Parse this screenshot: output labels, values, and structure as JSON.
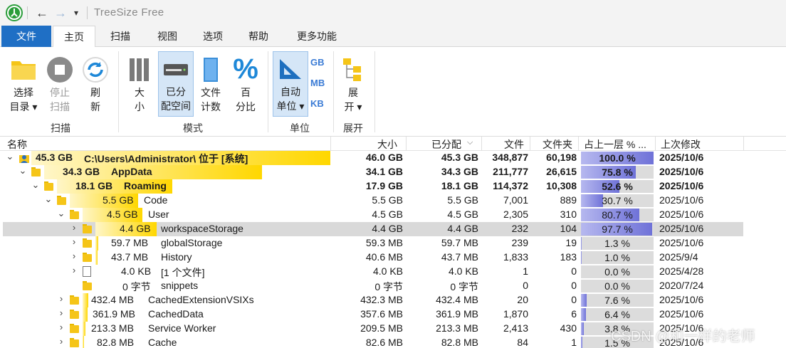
{
  "titlebar": {
    "title": "TreeSize Free",
    "quick_dropdown": "▾"
  },
  "menu": {
    "tabs": [
      "文件",
      "主页",
      "扫描",
      "视图",
      "选项",
      "帮助",
      "更多功能"
    ]
  },
  "ribbon": {
    "select_dir": [
      "选择",
      "目录 ▾"
    ],
    "stop_scan": [
      "停止",
      "扫描"
    ],
    "refresh": [
      "刷",
      "新"
    ],
    "size": [
      "大",
      "小"
    ],
    "allocated": [
      "已分",
      "配空间"
    ],
    "file_count": [
      "文件",
      "计数"
    ],
    "percent": [
      "百",
      "分比"
    ],
    "auto_unit": [
      "自动",
      "单位 ▾"
    ],
    "units": [
      "GB",
      "MB",
      "KB"
    ],
    "expand": [
      "展",
      "开 ▾"
    ],
    "groups": [
      "扫描",
      "模式",
      "单位",
      "展开"
    ]
  },
  "columns": [
    "名称",
    "大小",
    "已分配",
    "文件",
    "文件夹",
    "占上一层 % ...",
    "上次修改"
  ],
  "rows": [
    {
      "name_size": "45.3 GB",
      "name": "C:\\Users\\Administrator\\  位于  [系统]",
      "size": "46.0 GB",
      "allocated": "45.3 GB",
      "files": "348,877",
      "folders": "60,198",
      "pct": "100.0 %",
      "pct_value": 100.0,
      "modified": "2025/10/6",
      "bold": true
    },
    {
      "name_size": "34.3 GB",
      "name": "AppData",
      "size": "34.1 GB",
      "allocated": "34.3 GB",
      "files": "211,777",
      "folders": "26,615",
      "pct": "75.8 %",
      "pct_value": 75.8,
      "modified": "2025/10/6",
      "bold": true
    },
    {
      "name_size": "18.1 GB",
      "name": "Roaming",
      "size": "17.9 GB",
      "allocated": "18.1 GB",
      "files": "114,372",
      "folders": "10,308",
      "pct": "52.6 %",
      "pct_value": 52.6,
      "modified": "2025/10/6",
      "bold": true
    },
    {
      "name_size": "5.5 GB",
      "name": "Code",
      "size": "5.5 GB",
      "allocated": "5.5 GB",
      "files": "7,001",
      "folders": "889",
      "pct": "30.7 %",
      "pct_value": 30.7,
      "modified": "2025/10/6",
      "bold": false
    },
    {
      "name_size": "4.5 GB",
      "name": "User",
      "size": "4.5 GB",
      "allocated": "4.5 GB",
      "files": "2,305",
      "folders": "310",
      "pct": "80.7 %",
      "pct_value": 80.7,
      "modified": "2025/10/6",
      "bold": false
    },
    {
      "name_size": "4.4 GB",
      "name": "workspaceStorage",
      "size": "4.4 GB",
      "allocated": "4.4 GB",
      "files": "232",
      "folders": "104",
      "pct": "97.7 %",
      "pct_value": 97.7,
      "modified": "2025/10/6",
      "bold": false
    },
    {
      "name_size": "59.7 MB",
      "name": "globalStorage",
      "size": "59.3 MB",
      "allocated": "59.7 MB",
      "files": "239",
      "folders": "19",
      "pct": "1.3 %",
      "pct_value": 1.3,
      "modified": "2025/10/6",
      "bold": false
    },
    {
      "name_size": "43.7 MB",
      "name": "History",
      "size": "40.6 MB",
      "allocated": "43.7 MB",
      "files": "1,833",
      "folders": "183",
      "pct": "1.0 %",
      "pct_value": 1.0,
      "modified": "2025/9/4",
      "bold": false
    },
    {
      "name_size": "4.0 KB",
      "name": "[1 个文件]",
      "size": "4.0 KB",
      "allocated": "4.0 KB",
      "files": "1",
      "folders": "0",
      "pct": "0.0 %",
      "pct_value": 0.0,
      "modified": "2025/4/28",
      "bold": false
    },
    {
      "name_size": "0 字节",
      "name": "snippets",
      "size": "0 字节",
      "allocated": "0 字节",
      "files": "0",
      "folders": "0",
      "pct": "0.0 %",
      "pct_value": 0.0,
      "modified": "2020/7/24",
      "bold": false
    },
    {
      "name_size": "432.4 MB",
      "name": "CachedExtensionVSIXs",
      "size": "432.3 MB",
      "allocated": "432.4 MB",
      "files": "20",
      "folders": "0",
      "pct": "7.6 %",
      "pct_value": 7.6,
      "modified": "2025/10/6",
      "bold": false
    },
    {
      "name_size": "361.9 MB",
      "name": "CachedData",
      "size": "357.6 MB",
      "allocated": "361.9 MB",
      "files": "1,870",
      "folders": "6",
      "pct": "6.4 %",
      "pct_value": 6.4,
      "modified": "2025/10/6",
      "bold": false
    },
    {
      "name_size": "213.3 MB",
      "name": "Service Worker",
      "size": "209.5 MB",
      "allocated": "213.3 MB",
      "files": "2,413",
      "folders": "430",
      "pct": "3.8 %",
      "pct_value": 3.8,
      "modified": "2025/10/6",
      "bold": false
    },
    {
      "name_size": "82.8 MB",
      "name": "Cache",
      "size": "82.6 MB",
      "allocated": "82.8 MB",
      "files": "84",
      "folders": "1",
      "pct": "1.5 %",
      "pct_value": 1.5,
      "modified": "2025/10/6",
      "bold": false
    }
  ],
  "watermark": "CSDN @和一样的老师",
  "colors": {
    "accent": "#1f6fc5",
    "name_bar": "#ffd700",
    "pct_bar": "#6f72d8",
    "selected_row": "#d9d9d9"
  }
}
